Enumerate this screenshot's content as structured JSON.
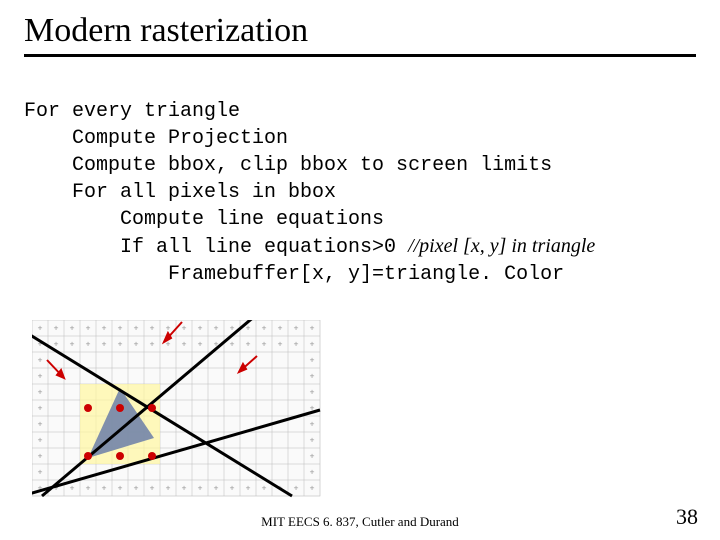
{
  "title": "Modern rasterization",
  "code": {
    "l1": "For every triangle",
    "l2": "    Compute Projection",
    "l3": "    Compute bbox, clip bbox to screen limits",
    "l4": "    For all pixels in bbox",
    "l5": "        Compute line equations",
    "l6a": "        If all line equations>0 ",
    "l6b": "//pixel [x, y] in triangle",
    "l7": "            Framebuffer[x, y]=triangle. Color"
  },
  "footer": "MIT EECS 6. 837, Cutler and Durand",
  "page_number": "38"
}
